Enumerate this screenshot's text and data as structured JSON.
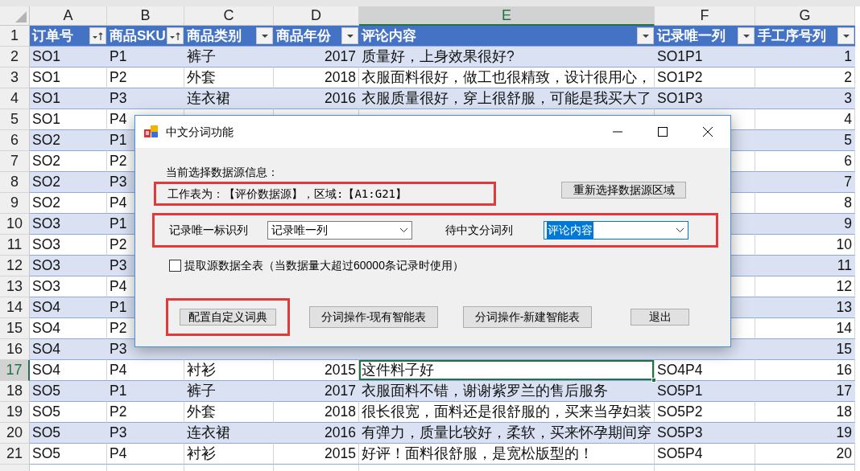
{
  "columns": [
    {
      "letter": "A",
      "selected": false
    },
    {
      "letter": "B",
      "selected": false
    },
    {
      "letter": "C",
      "selected": false
    },
    {
      "letter": "D",
      "selected": false
    },
    {
      "letter": "E",
      "selected": true
    },
    {
      "letter": "F",
      "selected": false
    },
    {
      "letter": "G",
      "selected": false
    }
  ],
  "table": {
    "header_row_number": "1",
    "headers": [
      {
        "label": "订单号",
        "sorted": true
      },
      {
        "label": "商品SKU",
        "sorted": true
      },
      {
        "label": "商品类别",
        "sorted": false
      },
      {
        "label": "商品年份",
        "sorted": false
      },
      {
        "label": "评论内容",
        "sorted": false
      },
      {
        "label": "记录唯一列",
        "sorted": false
      },
      {
        "label": "手工序号列",
        "sorted": false
      }
    ],
    "rows": [
      {
        "number": "2",
        "selected": false,
        "order": "SO1",
        "sku": "P1",
        "category": "裤子",
        "year": "2017",
        "comment": "质量好，上身效果很好?",
        "record_id": "SO1P1",
        "seq": "1"
      },
      {
        "number": "3",
        "selected": false,
        "order": "SO1",
        "sku": "P2",
        "category": "外套",
        "year": "2018",
        "comment": "衣服面料很好，做工也很精致，设计很用心，",
        "record_id": "SO1P2",
        "seq": "2"
      },
      {
        "number": "4",
        "selected": false,
        "order": "SO1",
        "sku": "P3",
        "category": "连衣裙",
        "year": "2016",
        "comment": "衣服质量很好，穿上很舒服，可能是我买大了",
        "record_id": "SO1P3",
        "seq": "3"
      },
      {
        "number": "5",
        "selected": false,
        "order": "SO1",
        "sku": "P4",
        "seq": "4"
      },
      {
        "number": "6",
        "selected": false,
        "order": "SO2",
        "sku": "P1",
        "seq": "5"
      },
      {
        "number": "7",
        "selected": false,
        "order": "SO2",
        "sku": "P2",
        "seq": "6"
      },
      {
        "number": "8",
        "selected": false,
        "order": "SO2",
        "sku": "P3",
        "seq": "7"
      },
      {
        "number": "9",
        "selected": false,
        "order": "SO2",
        "sku": "P4",
        "seq": "8"
      },
      {
        "number": "10",
        "selected": false,
        "order": "SO3",
        "sku": "P1",
        "seq": "9"
      },
      {
        "number": "11",
        "selected": false,
        "order": "SO3",
        "sku": "P2",
        "seq": "10"
      },
      {
        "number": "12",
        "selected": false,
        "order": "SO3",
        "sku": "P3",
        "seq": "11"
      },
      {
        "number": "13",
        "selected": false,
        "order": "SO3",
        "sku": "P4",
        "seq": "12"
      },
      {
        "number": "14",
        "selected": false,
        "order": "SO4",
        "sku": "P1",
        "seq": "13"
      },
      {
        "number": "15",
        "selected": false,
        "order": "SO4",
        "sku": "P2",
        "seq": "14"
      },
      {
        "number": "16",
        "selected": false,
        "order": "SO4",
        "sku": "P3",
        "seq": "15"
      },
      {
        "number": "17",
        "selected": true,
        "order": "SO4",
        "sku": "P4",
        "category": "衬衫",
        "year": "2015",
        "comment": "这件料子好",
        "record_id": "SO4P4",
        "seq": "16"
      },
      {
        "number": "18",
        "selected": false,
        "order": "SO5",
        "sku": "P1",
        "category": "裤子",
        "year": "2017",
        "comment": "衣服面料不错，谢谢紫罗兰的售后服务",
        "record_id": "SO5P1",
        "seq": "17"
      },
      {
        "number": "19",
        "selected": false,
        "order": "SO5",
        "sku": "P2",
        "category": "外套",
        "year": "2018",
        "comment": "很长很宽，面料还是很舒服的，买来当孕妇装",
        "record_id": "SO5P2",
        "seq": "18"
      },
      {
        "number": "20",
        "selected": false,
        "order": "SO5",
        "sku": "P3",
        "category": "连衣裙",
        "year": "2016",
        "comment": "有弹力，质量比较好，柔软，买来怀孕期间穿",
        "record_id": "SO5P3",
        "seq": "19"
      },
      {
        "number": "21",
        "selected": false,
        "order": "SO5",
        "sku": "P4",
        "category": "衬衫",
        "year": "2015",
        "comment": "好评！面料很舒服，是宽松版型的！",
        "record_id": "SO5P4",
        "seq": "20"
      }
    ]
  },
  "dialog": {
    "title": "中文分词功能",
    "source_label": "当前选择数据源信息：",
    "source_info": {
      "text": "工作表为：【评价数据源】，区域:【A1:G21】",
      "highlighted": true
    },
    "reselect_button": "重新选择数据源区域",
    "column_picker": {
      "highlighted": true,
      "fields": [
        {
          "label": "记录唯一标识列",
          "value": "记录唯一列",
          "focused": false
        },
        {
          "label": "待中文分词列",
          "value": "评论内容",
          "focused": true
        }
      ]
    },
    "full_table_option": {
      "label": "提取源数据全表（当数据量大超过60000条记录时使用）",
      "checked": false
    },
    "buttons": [
      {
        "label": "配置自定义词典",
        "highlighted": true
      },
      {
        "label": "分词操作-现有智能表",
        "highlighted": false
      },
      {
        "label": "分词操作-新建智能表",
        "highlighted": false
      },
      {
        "label": "退出",
        "highlighted": false
      }
    ]
  }
}
